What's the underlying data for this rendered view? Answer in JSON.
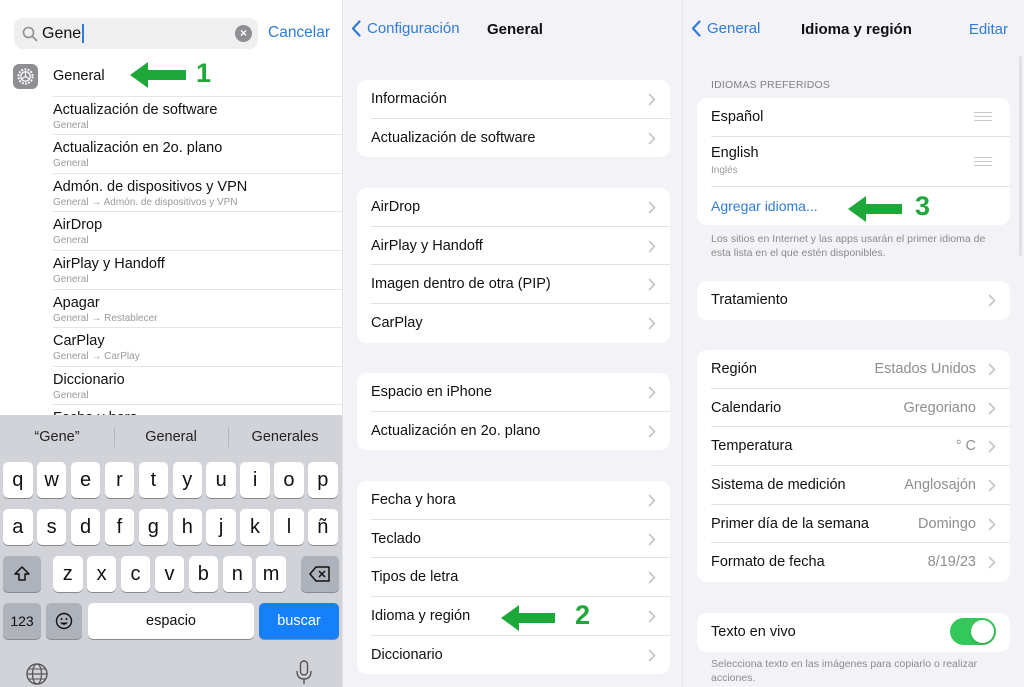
{
  "panel1": {
    "search": {
      "value": "Gene",
      "icon": "search-icon",
      "clear_icon": "clear-icon"
    },
    "cancel_label": "Cancelar",
    "results": [
      {
        "title": "General",
        "subtitle": "",
        "icon": "gear-icon"
      },
      {
        "title": "Actualización de software",
        "subtitle": "General"
      },
      {
        "title": "Actualización en 2o. plano",
        "subtitle": "General"
      },
      {
        "title": "Admón. de dispositivos y VPN",
        "subtitle": "General → Admón. de dispositivos y VPN"
      },
      {
        "title": "AirDrop",
        "subtitle": "General"
      },
      {
        "title": "AirPlay y Handoff",
        "subtitle": "General"
      },
      {
        "title": "Apagar",
        "subtitle": "General → Restablecer"
      },
      {
        "title": "CarPlay",
        "subtitle": "General → CarPlay"
      },
      {
        "title": "Diccionario",
        "subtitle": "General"
      },
      {
        "title": "Fecha y hora",
        "subtitle": ""
      }
    ],
    "annotation": "1",
    "keyboard": {
      "suggestions": [
        "“Gene”",
        "General",
        "Generales"
      ],
      "row1": [
        "q",
        "w",
        "e",
        "r",
        "t",
        "y",
        "u",
        "i",
        "o",
        "p"
      ],
      "row2": [
        "a",
        "s",
        "d",
        "f",
        "g",
        "h",
        "j",
        "k",
        "l",
        "ñ"
      ],
      "row3": [
        "z",
        "x",
        "c",
        "v",
        "b",
        "n",
        "m"
      ],
      "shift_icon": "shift-icon",
      "delete_icon": "delete-icon",
      "numbers_label": "123",
      "emoji_icon": "emoji-icon",
      "space_label": "espacio",
      "search_label": "buscar",
      "globe_icon": "globe-icon",
      "mic_icon": "microphone-icon"
    }
  },
  "panel2": {
    "back_label": "Configuración",
    "title": "General",
    "groups": [
      [
        "Información",
        "Actualización de software"
      ],
      [
        "AirDrop",
        "AirPlay y Handoff",
        "Imagen dentro de otra (PIP)",
        "CarPlay"
      ],
      [
        "Espacio en iPhone",
        "Actualización en 2o. plano"
      ],
      [
        "Fecha y hora",
        "Teclado",
        "Tipos de letra",
        "Idioma y región",
        "Diccionario"
      ]
    ],
    "annotation": "2"
  },
  "panel3": {
    "back_label": "General",
    "title": "Idioma y región",
    "edit_label": "Editar",
    "preferred_header": "IDIOMAS PREFERIDOS",
    "languages": [
      {
        "name": "Español",
        "subtitle": ""
      },
      {
        "name": "English",
        "subtitle": "Inglés"
      }
    ],
    "add_language": "Agregar idioma...",
    "languages_footer": "Los sitios en Internet y las apps usarán el primer idioma de esta lista en el que estén disponibles.",
    "treatment": "Tratamiento",
    "region_rows": [
      {
        "label": "Región",
        "value": "Estados Unidos"
      },
      {
        "label": "Calendario",
        "value": "Gregoriano"
      },
      {
        "label": "Temperatura",
        "value": "° C"
      },
      {
        "label": "Sistema de medición",
        "value": "Anglosajón"
      },
      {
        "label": "Primer día de la semana",
        "value": "Domingo"
      },
      {
        "label": "Formato de fecha",
        "value": "8/19/23"
      }
    ],
    "live_text": {
      "label": "Texto en vivo",
      "enabled": true
    },
    "live_text_footer": "Selecciona texto en las imágenes para copiarlo o realizar acciones.",
    "annotation": "3"
  },
  "colors": {
    "accent": "#2f7bd8",
    "annotation": "#1fa83a",
    "toggle_on": "#34c759",
    "search_key": "#1580fa"
  }
}
